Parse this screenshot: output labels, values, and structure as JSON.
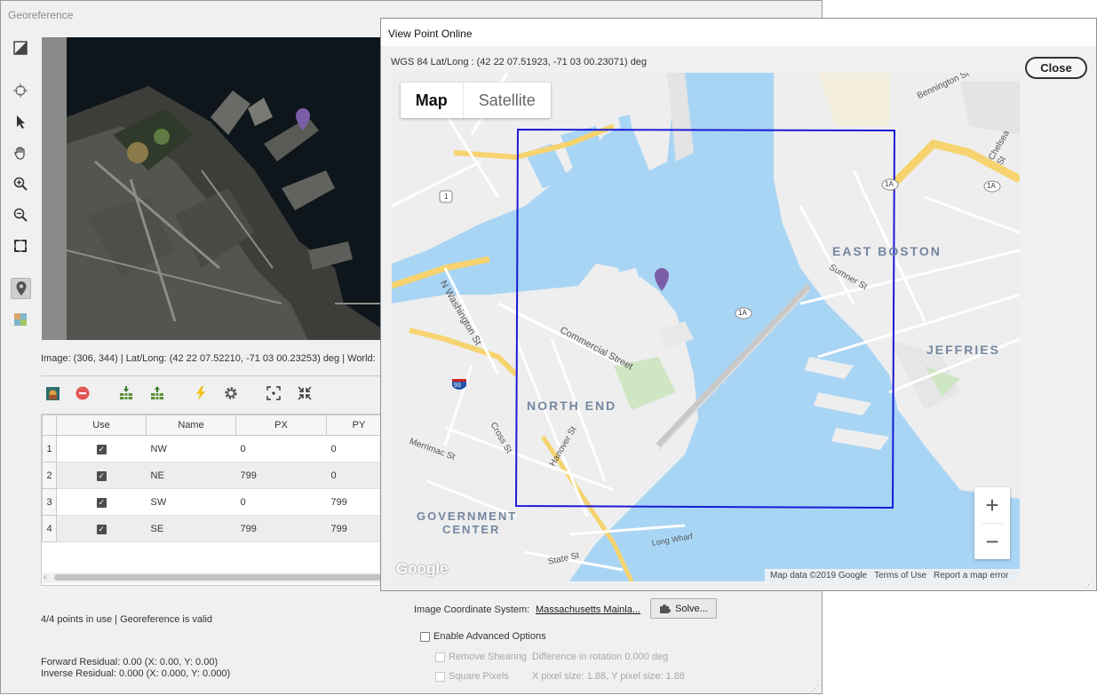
{
  "georeference": {
    "title": "Georeference",
    "image_status": "Image: (306, 344) | Lat/Long: (42 22 07.52210, -71 03 00.23253) deg | World:",
    "table": {
      "headers": [
        "Use",
        "Name",
        "PX",
        "PY"
      ],
      "rows": [
        {
          "num": "1",
          "name": "NW",
          "px": "0",
          "py": "0"
        },
        {
          "num": "2",
          "name": "NE",
          "px": "799",
          "py": "0"
        },
        {
          "num": "3",
          "name": "SW",
          "px": "0",
          "py": "799"
        },
        {
          "num": "4",
          "name": "SE",
          "px": "799",
          "py": "799"
        }
      ]
    },
    "points_status": "4/4 points in use | Georeference is valid",
    "forward_residual": "Forward Residual: 0.00 (X: 0.00, Y: 0.00)",
    "inverse_residual": "Inverse Residual: 0.000 (X: 0.000, Y: 0.000)",
    "coord_system_label": "Image Coordinate System:",
    "coord_system_value": "Massachusetts Mainla...",
    "solve_label": "Solve...",
    "enable_advanced_label": "Enable Advanced Options",
    "remove_shearing_label": "Remove Shearing",
    "rotation_diff": "Difference in rotation 0.000 deg",
    "square_pixels_label": "Square Pixels",
    "pixel_size": "X pixel size: 1.88, Y pixel size: 1.88"
  },
  "view_point": {
    "title": "View Point Online",
    "coords": "WGS 84 Lat/Long :   (42 22 07.51923, -71 03 00.23071) deg",
    "close_label": "Close",
    "map_tab": "Map",
    "satellite_tab": "Satellite",
    "attribution": [
      "Map data ©2019 Google",
      "Terms of Use",
      "Report a map error"
    ],
    "google_logo": "Google",
    "zoom_in": "+",
    "zoom_out": "−",
    "map_labels": {
      "north_end": "NORTH END",
      "east_boston": "EAST BOSTON",
      "government_center": "GOVERNMENT CENTER",
      "government_center_1": "GOVERNMENT",
      "government_center_2": "CENTER",
      "jeffries": "JEFFRIES",
      "commercial_st": "Commercial Street",
      "n_washington_st": "N Washington St",
      "hanover_st": "Hanover St",
      "cross_st": "Cross St",
      "merrimac_st": "Merrimac St",
      "state_st": "State St",
      "bennington_st": "Bennington St",
      "sumner_st": "Sumner St",
      "chelsea_st": "Chelsea St",
      "long_wharf": "Long Wharf",
      "route_1a": "1A",
      "route_1": "1",
      "route_93": "93"
    }
  },
  "colors": {
    "water": "#a9d5f5",
    "land": "#ededed",
    "highway": "#f6d36e",
    "selection_box": "#1a1ad6",
    "marker": "#7b5ea7"
  }
}
